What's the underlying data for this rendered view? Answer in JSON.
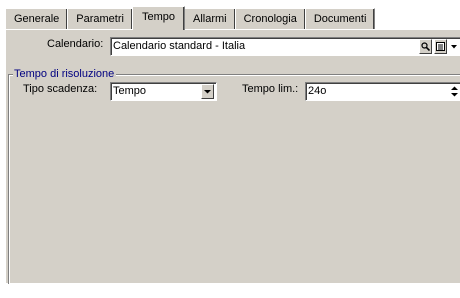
{
  "tabs": [
    {
      "label": "Generale",
      "active": false
    },
    {
      "label": "Parametri",
      "active": false
    },
    {
      "label": "Tempo",
      "active": true
    },
    {
      "label": "Allarmi",
      "active": false
    },
    {
      "label": "Cronologia",
      "active": false
    },
    {
      "label": "Documenti",
      "active": false
    }
  ],
  "calendar": {
    "label": "Calendario:",
    "value": "Calendario standard - Italia",
    "icons": [
      "search-icon",
      "list-icon",
      "chevron-down-icon"
    ]
  },
  "resolution_group": {
    "title": "Tempo di risoluzione",
    "deadline_type": {
      "label": "Tipo scadenza:",
      "value": "Tempo"
    },
    "time_limit": {
      "label": "Tempo lim.:",
      "value": "24o"
    }
  },
  "colors": {
    "panel": "#d4d0c8",
    "group_title": "#000080",
    "field": "#ffffff"
  }
}
